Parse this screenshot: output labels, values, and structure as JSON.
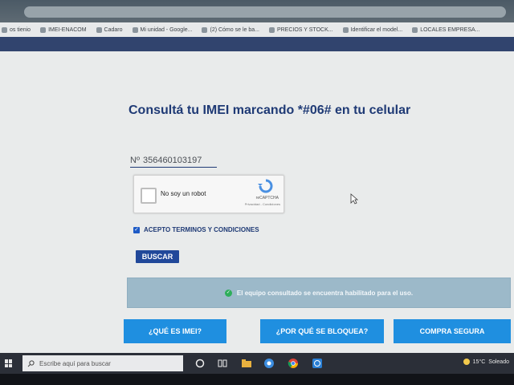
{
  "bookmarks": [
    {
      "label": "os tienio",
      "icon": "page-icon"
    },
    {
      "label": "IMEI-ENACOM",
      "icon": "site-icon"
    },
    {
      "label": "Cadaro",
      "icon": "folder-icon"
    },
    {
      "label": "Mi unidad - Google...",
      "icon": "google-icon"
    },
    {
      "label": "(2) Cómo se le ba...",
      "icon": "video-icon"
    },
    {
      "label": "PRECIOS Y STOCK...",
      "icon": "sheet-icon"
    },
    {
      "label": "Identificar el model...",
      "icon": "apple-icon"
    },
    {
      "label": "LOCALES EMPRESA...",
      "icon": "doc-icon"
    }
  ],
  "page": {
    "title": "Consultá tu IMEI marcando *#06# en tu celular",
    "imei_prefix": "Nº",
    "imei_value": "356460103197",
    "captcha": {
      "label": "No soy un robot",
      "brand": "reCAPTCHA",
      "links": "Privacidad - Condiciones"
    },
    "terms_label": "ACEPTO TERMINOS Y CONDICIONES",
    "terms_checked": true,
    "search_button": "BUSCAR",
    "result_message": "El equipo consultado se encuentra habilitado para el uso.",
    "buttons": {
      "que_es": "¿QUÉ ES IMEI?",
      "por_que": "¿POR QUÉ SE BLOQUEA?",
      "compra": "COMPRA SEGURA"
    }
  },
  "taskbar": {
    "search_placeholder": "Escribe aquí para buscar",
    "weather_temp": "15°C",
    "weather_text": "Soleado"
  },
  "colors": {
    "title": "#1f3a75",
    "button_blue": "#1f8fe0",
    "buscar": "#21489a",
    "result_bg": "#9cb9c9"
  }
}
